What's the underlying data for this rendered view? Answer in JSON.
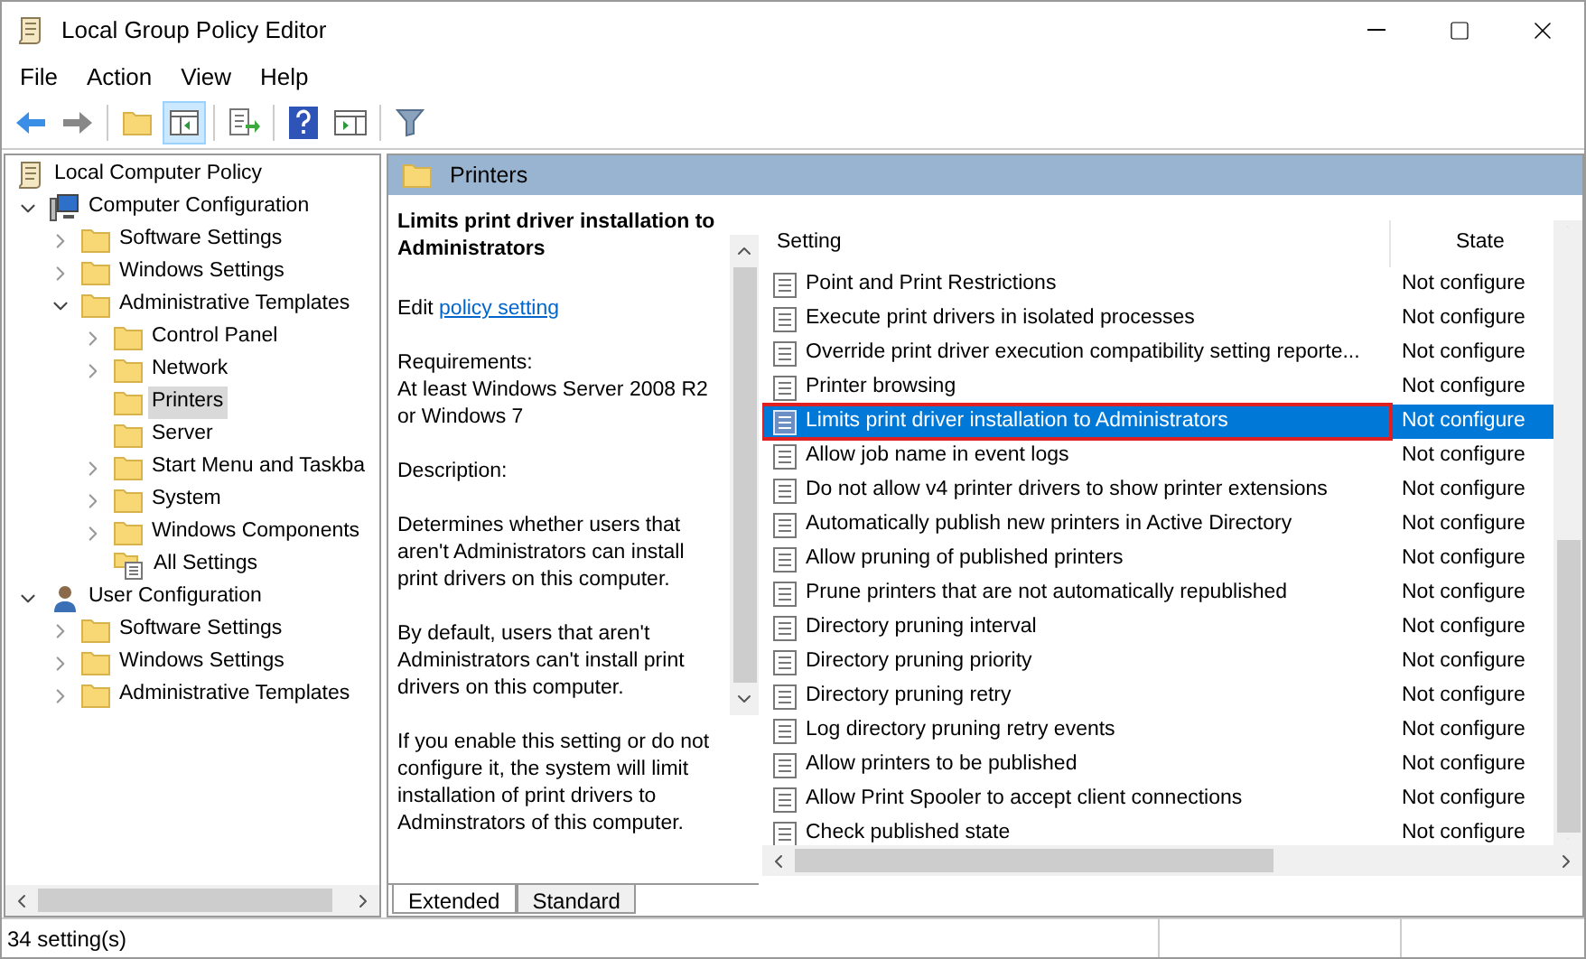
{
  "window": {
    "title": "Local Group Policy Editor"
  },
  "menu": [
    "File",
    "Action",
    "View",
    "Help"
  ],
  "tree": [
    {
      "label": "Local Computer Policy",
      "kind": "policy",
      "selected": false,
      "children": [
        {
          "label": "Computer Configuration",
          "kind": "computer",
          "selected": false,
          "expanded": true,
          "children": [
            {
              "label": "Software Settings",
              "kind": "folder",
              "selected": false,
              "expanded": false
            },
            {
              "label": "Windows Settings",
              "kind": "folder",
              "selected": false,
              "expanded": false
            },
            {
              "label": "Administrative Templates",
              "kind": "folder",
              "selected": false,
              "expanded": true,
              "children": [
                {
                  "label": "Control Panel",
                  "kind": "folder",
                  "selected": false,
                  "expanded": false
                },
                {
                  "label": "Network",
                  "kind": "folder",
                  "selected": false,
                  "expanded": false
                },
                {
                  "label": "Printers",
                  "kind": "folder",
                  "selected": true
                },
                {
                  "label": "Server",
                  "kind": "folder",
                  "selected": false
                },
                {
                  "label": "Start Menu and Taskba",
                  "kind": "folder",
                  "selected": false,
                  "expanded": false
                },
                {
                  "label": "System",
                  "kind": "folder",
                  "selected": false,
                  "expanded": false
                },
                {
                  "label": "Windows Components",
                  "kind": "folder",
                  "selected": false,
                  "expanded": false
                },
                {
                  "label": "All Settings",
                  "kind": "all",
                  "selected": false
                }
              ]
            }
          ]
        },
        {
          "label": "User Configuration",
          "kind": "user",
          "selected": false,
          "expanded": true,
          "children": [
            {
              "label": "Software Settings",
              "kind": "folder",
              "selected": false,
              "expanded": false
            },
            {
              "label": "Windows Settings",
              "kind": "folder",
              "selected": false,
              "expanded": false
            },
            {
              "label": "Administrative Templates",
              "kind": "folder",
              "selected": false,
              "expanded": false
            }
          ]
        }
      ]
    }
  ],
  "header": {
    "title": "Printers"
  },
  "description": {
    "title": "Limits print driver installation to Administrators",
    "edit_prefix": "Edit",
    "edit_link": "policy setting",
    "paragraphs": [
      "Requirements:\nAt least Windows Server 2008 R2 or Windows 7",
      "Description:",
      "Determines whether users that aren't Administrators can install print drivers on this computer.",
      "By default, users that aren't Administrators can't install print drivers on this computer.",
      "If you enable this setting or do not configure it, the system will limit installation of print drivers to Adminstrators of this computer."
    ]
  },
  "tabs": [
    {
      "label": "Extended",
      "selected": true
    },
    {
      "label": "Standard",
      "selected": false
    }
  ],
  "table": {
    "columns": [
      "Setting",
      "State"
    ],
    "rows": [
      {
        "setting": "Point and Print Restrictions",
        "state": "Not configure",
        "selected": false,
        "highlighted": false
      },
      {
        "setting": "Execute print drivers in isolated processes",
        "state": "Not configure",
        "selected": false,
        "highlighted": false
      },
      {
        "setting": "Override print driver execution compatibility setting reporte...",
        "state": "Not configure",
        "selected": false,
        "highlighted": false
      },
      {
        "setting": "Printer browsing",
        "state": "Not configure",
        "selected": false,
        "highlighted": false
      },
      {
        "setting": "Limits print driver installation to Administrators",
        "state": "Not configure",
        "selected": true,
        "highlighted": true
      },
      {
        "setting": "Allow job name in event logs",
        "state": "Not configure",
        "selected": false,
        "highlighted": false
      },
      {
        "setting": "Do not allow v4 printer drivers to show printer extensions",
        "state": "Not configure",
        "selected": false,
        "highlighted": false
      },
      {
        "setting": "Automatically publish new printers in Active Directory",
        "state": "Not configure",
        "selected": false,
        "highlighted": false
      },
      {
        "setting": "Allow pruning of published printers",
        "state": "Not configure",
        "selected": false,
        "highlighted": false
      },
      {
        "setting": "Prune printers that are not automatically republished",
        "state": "Not configure",
        "selected": false,
        "highlighted": false
      },
      {
        "setting": "Directory pruning interval",
        "state": "Not configure",
        "selected": false,
        "highlighted": false
      },
      {
        "setting": "Directory pruning priority",
        "state": "Not configure",
        "selected": false,
        "highlighted": false
      },
      {
        "setting": "Directory pruning retry",
        "state": "Not configure",
        "selected": false,
        "highlighted": false
      },
      {
        "setting": "Log directory pruning retry events",
        "state": "Not configure",
        "selected": false,
        "highlighted": false
      },
      {
        "setting": "Allow printers to be published",
        "state": "Not configure",
        "selected": false,
        "highlighted": false
      },
      {
        "setting": "Allow Print Spooler to accept client connections",
        "state": "Not configure",
        "selected": false,
        "highlighted": false
      },
      {
        "setting": "Check published state",
        "state": "Not configure",
        "selected": false,
        "highlighted": false
      }
    ]
  },
  "status_bar": "34 setting(s)"
}
